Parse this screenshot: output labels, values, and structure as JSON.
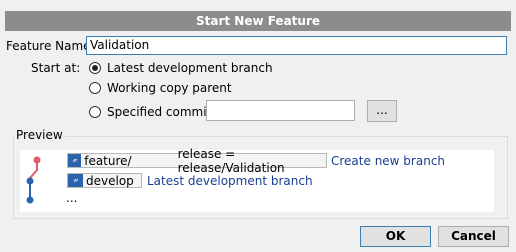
{
  "dialog": {
    "title": "Start New Feature"
  },
  "form": {
    "feature_name_label": "Feature Name:",
    "feature_name_value": "Validation",
    "start_at_label": "Start at:",
    "options": [
      {
        "label": "Latest development branch",
        "checked": true
      },
      {
        "label": "Working copy parent",
        "checked": false
      },
      {
        "label": "Specified commit:",
        "checked": false
      }
    ],
    "commit_value": "",
    "browse_label": "..."
  },
  "preview": {
    "label": "Preview",
    "new_branch": {
      "prefix": "feature/",
      "name": "release = release/Validation",
      "action": "Create new branch"
    },
    "base_branch": {
      "name": "develop",
      "description": "Latest development branch"
    },
    "more": "..."
  },
  "buttons": {
    "ok": "OK",
    "cancel": "Cancel"
  },
  "colors": {
    "title_bar": "#8c8c8c",
    "new_node": "#e05a6a",
    "graph_node": "#2c63ad",
    "link_text": "#1a3f92"
  },
  "icons": {
    "branch": "branch-icon"
  }
}
